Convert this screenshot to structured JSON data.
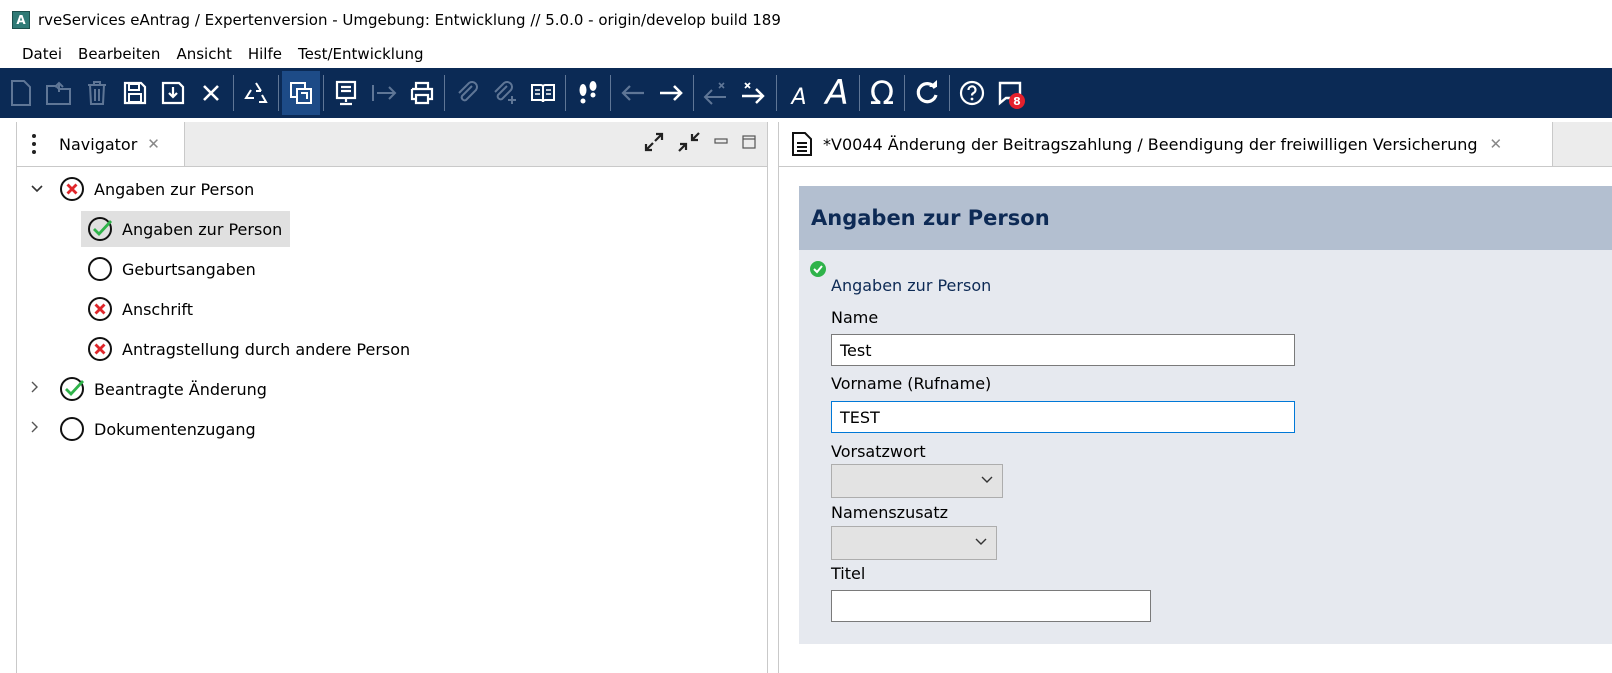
{
  "window": {
    "app_icon_letter": "A",
    "title": "rveServices eAntrag / Expertenversion - Umgebung: Entwicklung   // 5.0.0 - origin/develop build 189"
  },
  "menu": {
    "items": [
      "Datei",
      "Bearbeiten",
      "Ansicht",
      "Hilfe",
      "Test/Entwicklung"
    ]
  },
  "toolbar": {
    "background": "#0b2a55",
    "buttons": [
      {
        "icon": "new-document-icon",
        "enabled": false
      },
      {
        "icon": "open-folder-icon",
        "enabled": false
      },
      {
        "icon": "trash-icon",
        "enabled": false
      },
      {
        "icon": "save-icon",
        "enabled": true
      },
      {
        "icon": "save-as-icon",
        "enabled": true
      },
      {
        "icon": "close-x-icon",
        "enabled": true
      },
      {
        "icon": "recycle-icon",
        "enabled": true
      },
      {
        "icon": "window-copy-icon",
        "enabled": true,
        "active": true
      },
      {
        "icon": "monitor-icon",
        "enabled": true
      },
      {
        "icon": "send-arrow-icon",
        "enabled": false
      },
      {
        "icon": "printer-icon",
        "enabled": true
      },
      {
        "icon": "attachment-icon",
        "enabled": false
      },
      {
        "icon": "attachment-add-icon",
        "enabled": false
      },
      {
        "icon": "book-icon",
        "enabled": true
      },
      {
        "icon": "footsteps-icon",
        "enabled": true
      },
      {
        "icon": "arrow-left-icon",
        "enabled": false
      },
      {
        "icon": "arrow-right-icon",
        "enabled": true
      },
      {
        "icon": "arrow-left-x-icon",
        "enabled": false
      },
      {
        "icon": "arrow-right-x-icon",
        "enabled": true
      },
      {
        "icon": "font-small-icon",
        "enabled": true
      },
      {
        "icon": "font-large-icon",
        "enabled": true
      },
      {
        "icon": "omega-icon",
        "enabled": true
      },
      {
        "icon": "refresh-icon",
        "enabled": true
      },
      {
        "icon": "help-icon",
        "enabled": true
      },
      {
        "icon": "messages-icon",
        "enabled": true,
        "badge": "8"
      }
    ]
  },
  "navigator": {
    "tab_label": "Navigator",
    "tree": [
      {
        "label": "Angaben zur Person",
        "status": "error",
        "expanded": true,
        "level": 0
      },
      {
        "label": "Angaben zur Person",
        "status": "ok",
        "level": 1,
        "selected": true
      },
      {
        "label": "Geburtsangaben",
        "status": "empty",
        "level": 1
      },
      {
        "label": "Anschrift",
        "status": "error",
        "level": 1
      },
      {
        "label": "Antragstellung durch andere Person",
        "status": "error",
        "level": 1
      },
      {
        "label": "Beantragte Änderung",
        "status": "ok",
        "expanded": false,
        "level": 0
      },
      {
        "label": "Dokumentenzugang",
        "status": "empty",
        "expanded": false,
        "level": 0
      }
    ]
  },
  "editor": {
    "tab_label": "*V0044 Änderung der Beitragszahlung / Beendigung der freiwilligen Versicherung",
    "section_title": "Angaben zur Person",
    "subsection_title": "Angaben zur Person",
    "fields": {
      "name": {
        "label": "Name",
        "value": "Test"
      },
      "vorname": {
        "label": "Vorname (Rufname)",
        "value": "TEST"
      },
      "vorsatzwort": {
        "label": "Vorsatzwort",
        "value": ""
      },
      "namenszusatz": {
        "label": "Namenszusatz",
        "value": ""
      },
      "titel": {
        "label": "Titel",
        "value": ""
      }
    }
  },
  "colors": {
    "ok_green": "#2fb34a",
    "error_red": "#e0262b",
    "section_band": "#b3bfd0",
    "form_bg": "#e6e9ef",
    "focus_border": "#0078d7"
  }
}
